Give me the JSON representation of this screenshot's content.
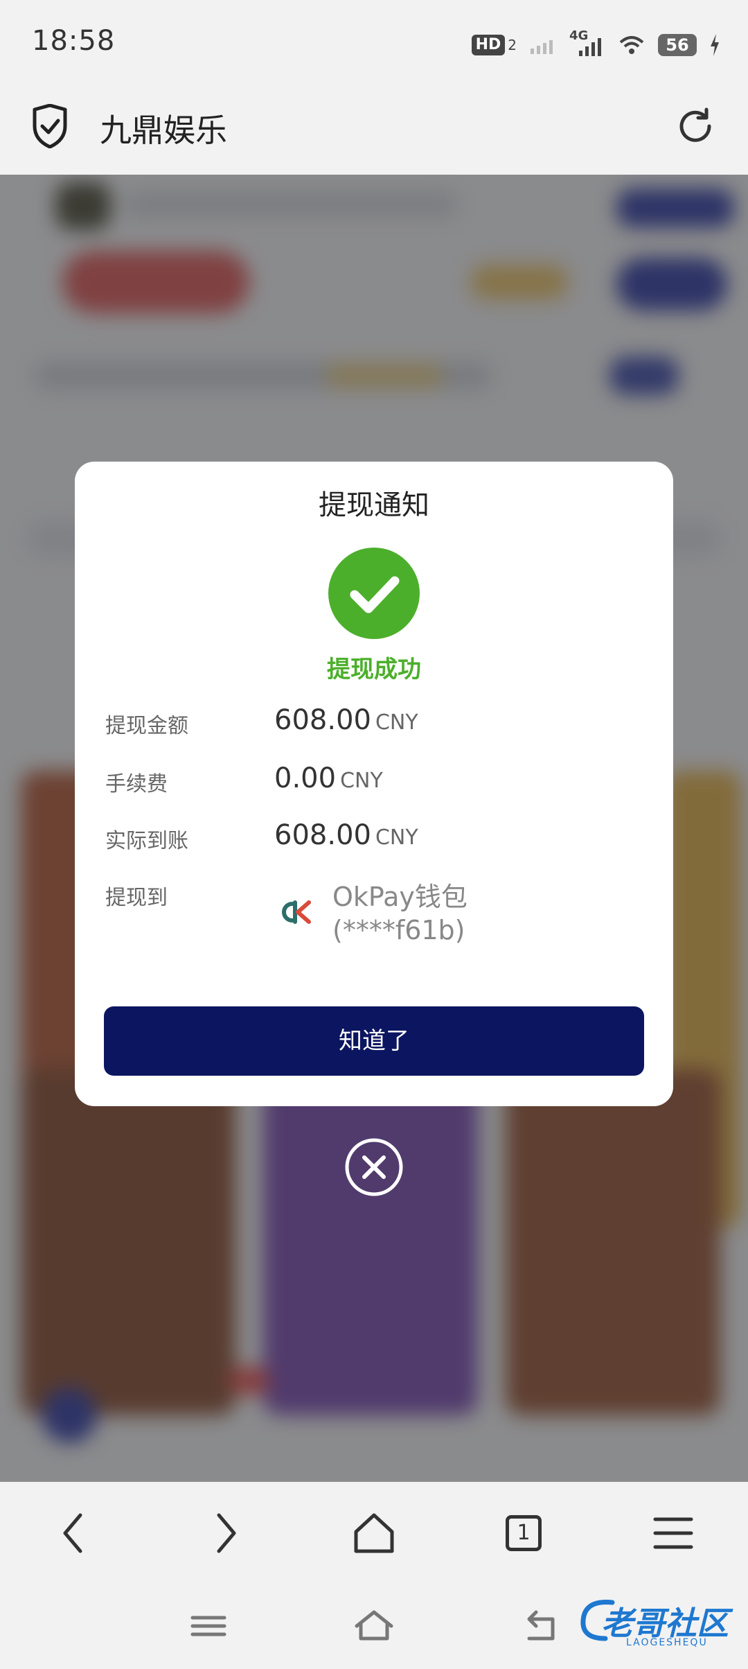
{
  "status_bar": {
    "time": "18:58",
    "hd_label": "HD",
    "hd_sub": "2",
    "network": "4G",
    "battery": "56"
  },
  "browser": {
    "site_title": "九鼎娱乐",
    "tab_count": "1"
  },
  "dialog": {
    "title": "提现通知",
    "status": "提现成功",
    "rows": [
      {
        "label": "提现金额",
        "amount": "608.00",
        "currency": "CNY"
      },
      {
        "label": "手续费",
        "amount": "0.00",
        "currency": "CNY"
      },
      {
        "label": "实际到账",
        "amount": "608.00",
        "currency": "CNY"
      }
    ],
    "destination_label": "提现到",
    "wallet_name": "OkPay钱包",
    "wallet_account": "(****f61b)",
    "confirm_label": "知道了"
  },
  "watermark": {
    "text": "老哥社区",
    "sub": "LAOGESHEQU"
  },
  "colors": {
    "success": "#4caf2b",
    "primary_button": "#0c1560"
  }
}
